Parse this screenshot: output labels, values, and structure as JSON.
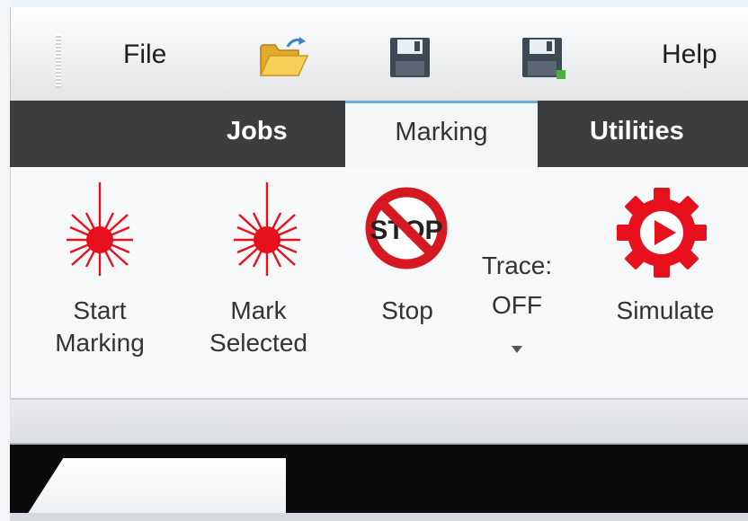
{
  "menu": {
    "file_label": "File",
    "help_label": "Help",
    "icons": [
      "open-folder-icon",
      "save-icon",
      "save-as-icon"
    ]
  },
  "tabs": {
    "jobs": "Jobs",
    "marking": "Marking",
    "utilities": "Utilities",
    "active": "Marking"
  },
  "ribbon": {
    "start_marking": "Start\nMarking",
    "mark_selected": "Mark\nSelected",
    "stop": "Stop",
    "stop_sign_text": "STOP",
    "trace_line1": "Trace:",
    "trace_line2": "OFF",
    "simulate": "Simulate"
  },
  "document_tab": {
    "label": ""
  },
  "colors": {
    "accent_red": "#e8101c",
    "tab_strip": "#3c3d3e",
    "active_tab_border": "#6aaede",
    "save_icon": "#3d4a56",
    "folder": "#f2c54b"
  }
}
